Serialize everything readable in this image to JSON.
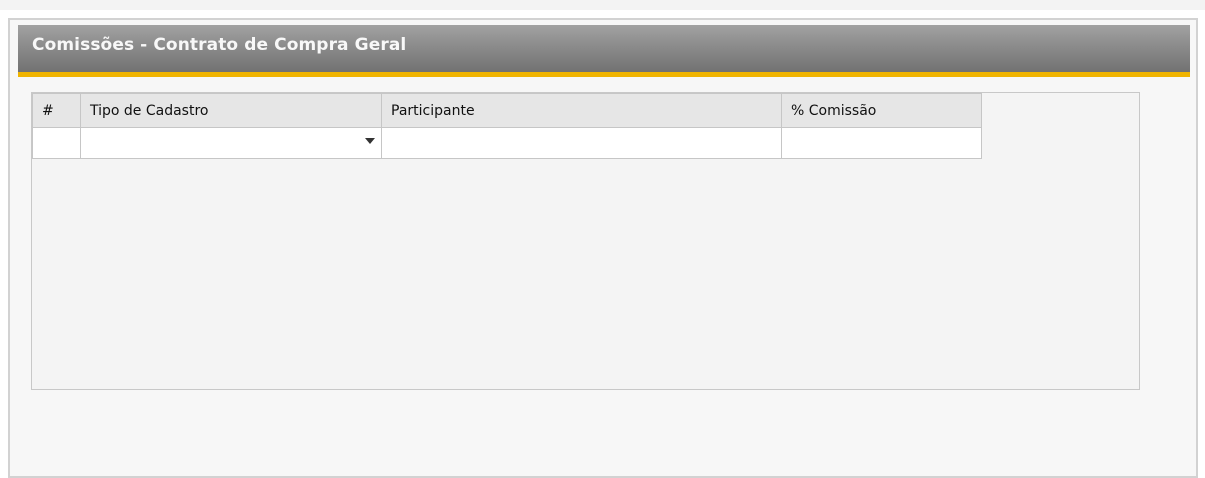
{
  "window": {
    "title": "Comissões - Contrato de Compra Geral"
  },
  "colors": {
    "title_bar": "#8b8b8b",
    "accent": "#f0b400",
    "header_cell": "#e6e6e6",
    "background": "#f4f4f4"
  },
  "table": {
    "columns": [
      "#",
      "Tipo de Cadastro",
      "Participante",
      "% Comissão"
    ],
    "rows": [
      {
        "num": "",
        "tipo": "",
        "participante": "",
        "comissao": ""
      }
    ],
    "icons": {
      "dropdown": "chevron-down-icon"
    }
  }
}
